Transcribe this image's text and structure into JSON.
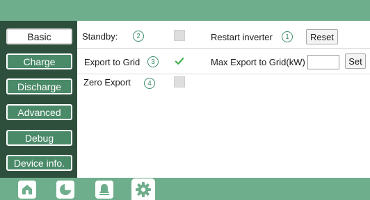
{
  "sidebar": {
    "items": [
      {
        "label": "Basic",
        "active": true
      },
      {
        "label": "Charge",
        "active": false
      },
      {
        "label": "Discharge",
        "active": false
      },
      {
        "label": "Advanced",
        "active": false
      },
      {
        "label": "Debug",
        "active": false
      },
      {
        "label": "Device info.",
        "active": false
      }
    ]
  },
  "settings": {
    "standby": {
      "label": "Standby:",
      "marker": "2",
      "checked": false
    },
    "restart": {
      "label": "Restart inverter",
      "marker": "1",
      "button": "Reset"
    },
    "export_to_grid": {
      "label": "Export to Grid",
      "marker": "3",
      "checked": true
    },
    "max_export": {
      "label": "Max Export to Grid(kW)",
      "value": "",
      "button": "Set"
    },
    "zero_export": {
      "label": "Zero Export",
      "marker": "4",
      "checked": false
    }
  },
  "bottom_nav": {
    "tabs": [
      {
        "icon": "home-icon",
        "active": false
      },
      {
        "icon": "pie-chart-icon",
        "active": false
      },
      {
        "icon": "bell-icon",
        "active": false
      },
      {
        "icon": "gear-icon",
        "active": true
      }
    ]
  },
  "colors": {
    "accent": "#6fae8c",
    "sidebar_bg": "#2f4f3d",
    "button_bg": "#4b8a69",
    "marker": "#3d8f6a",
    "check": "#3aa845"
  }
}
